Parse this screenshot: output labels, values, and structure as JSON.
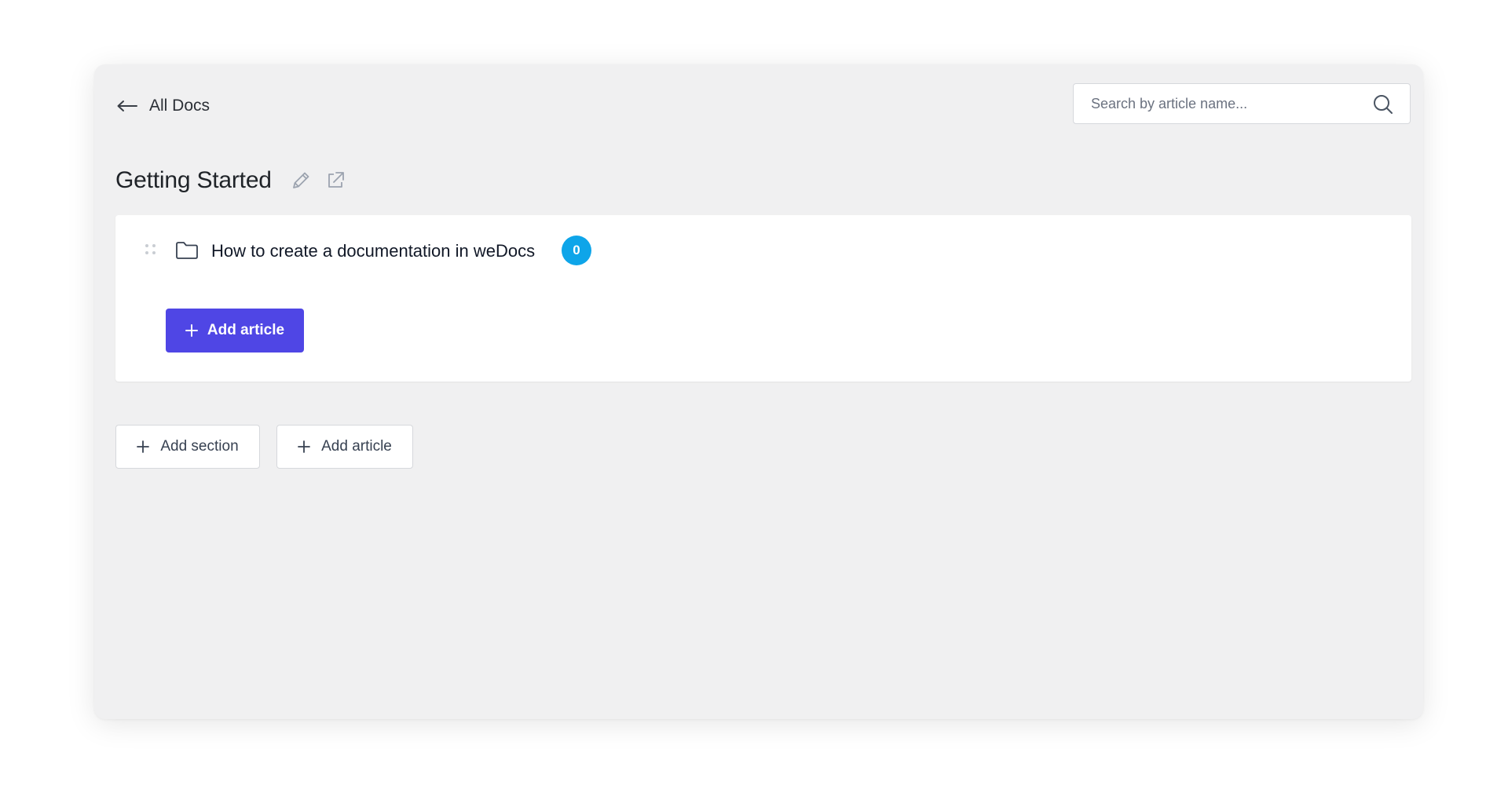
{
  "header": {
    "back_label": "All Docs",
    "search_placeholder": "Search by article name..."
  },
  "doc": {
    "title": "Getting Started"
  },
  "sections": [
    {
      "title": "How to create a documentation in weDocs",
      "article_count": "0",
      "add_article_label": "Add article"
    }
  ],
  "footer_actions": {
    "add_section_label": "Add section",
    "add_article_label": "Add article"
  },
  "colors": {
    "primary": "#4f46e5",
    "badge": "#0ea5e9",
    "panel_bg": "#f0f0f1"
  },
  "icons": {
    "back": "arrow-left-icon",
    "search": "search-icon",
    "edit": "pencil-icon",
    "external": "external-link-icon",
    "drag": "drag-handle-icon",
    "folder": "folder-icon",
    "plus": "plus-icon"
  }
}
